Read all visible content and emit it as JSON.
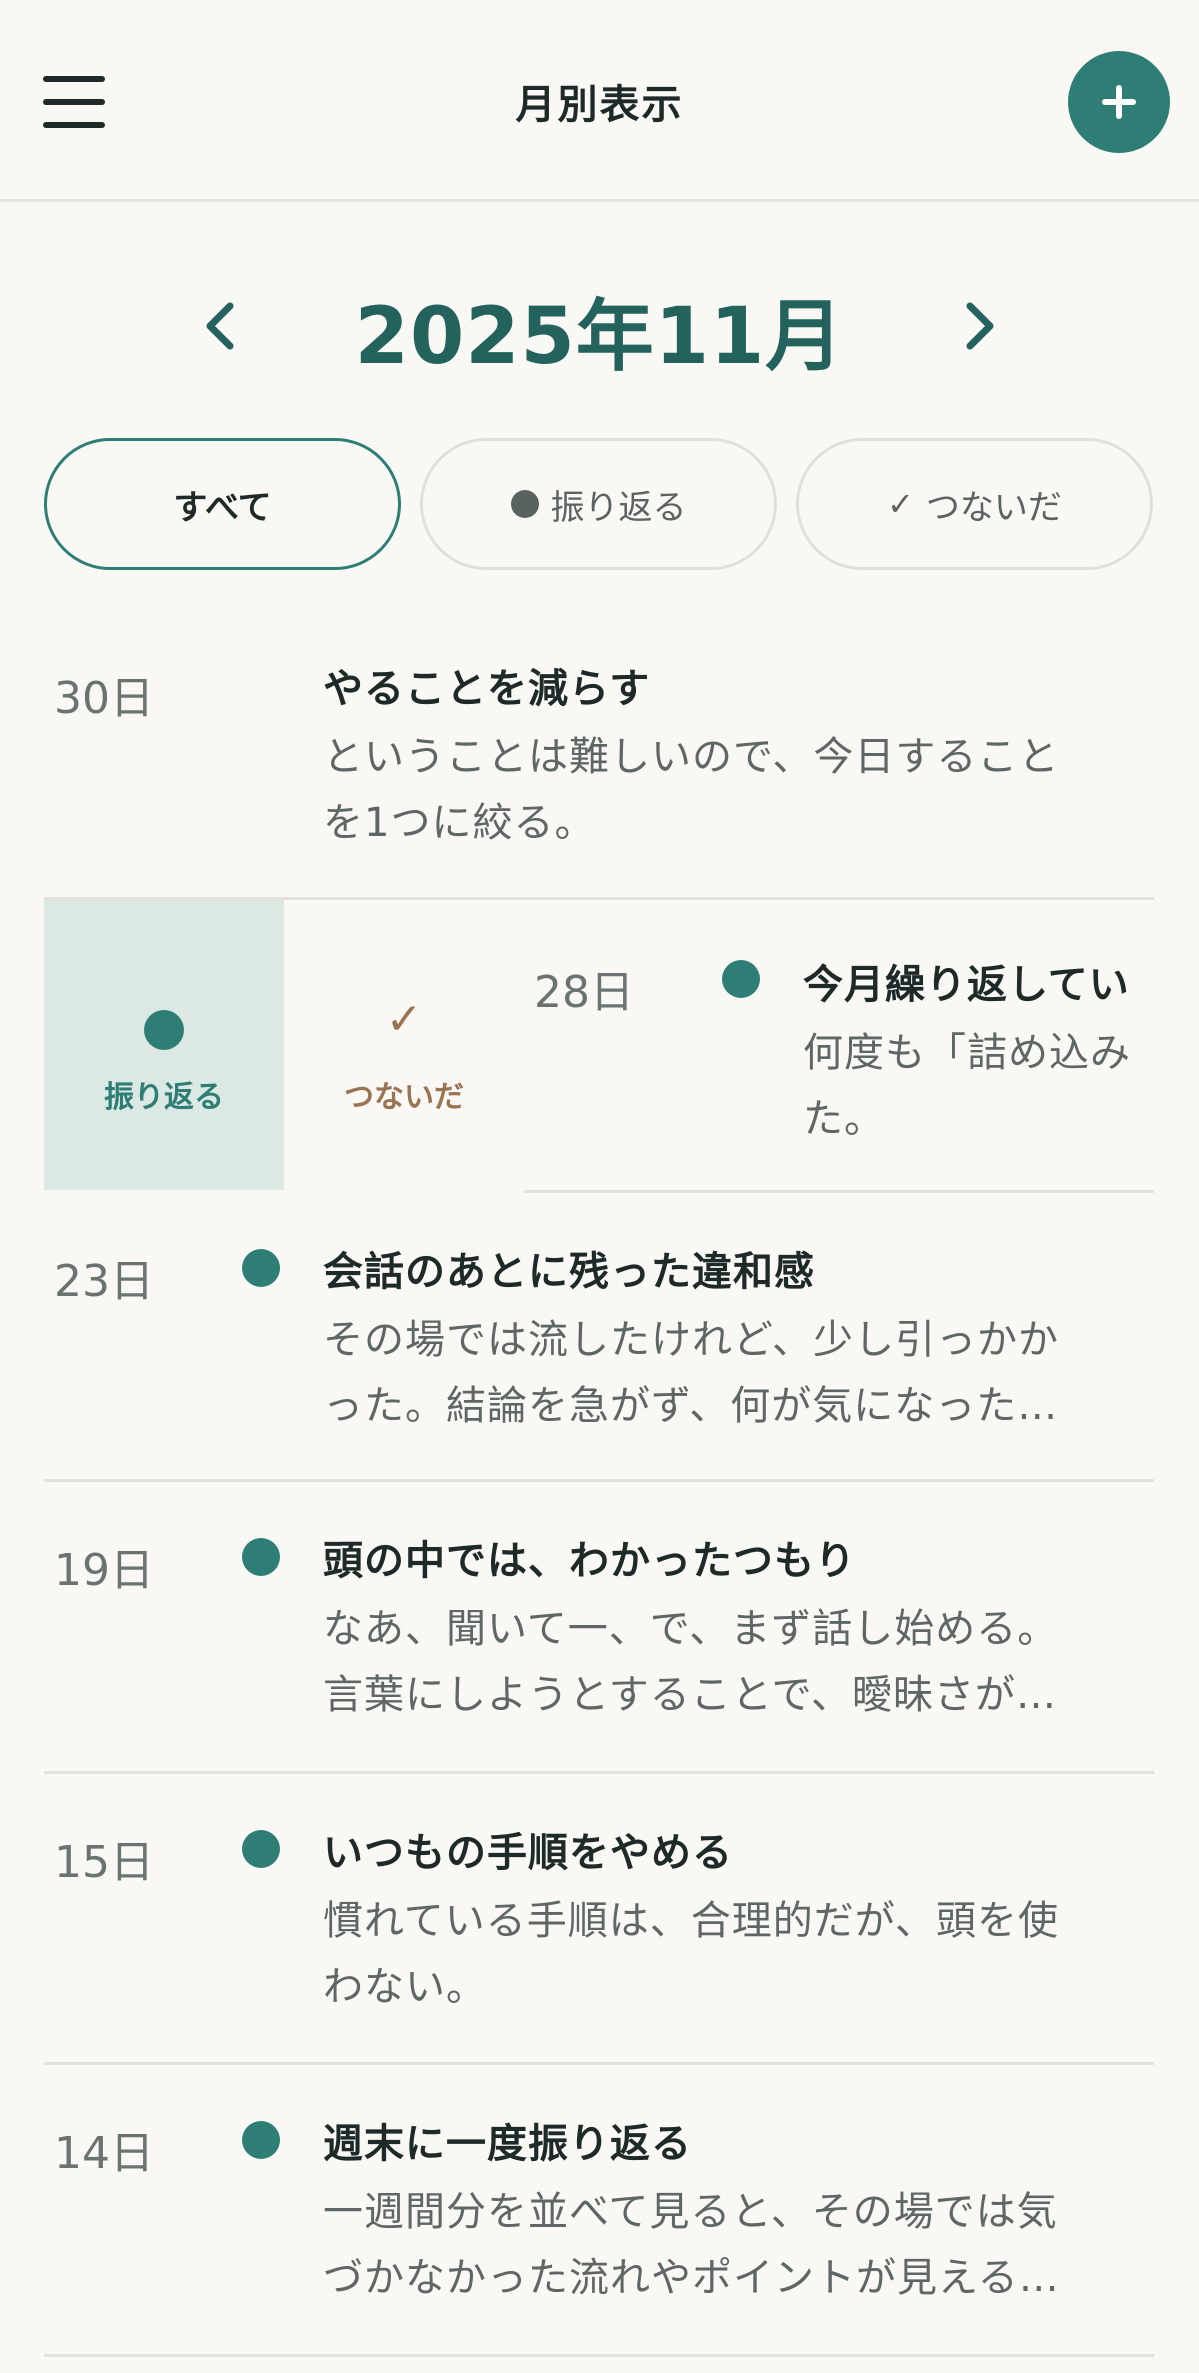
{
  "header": {
    "title": "月別表示"
  },
  "month_nav": {
    "title": "2025年11月"
  },
  "filters": {
    "all": "すべて",
    "reflect": "振り返る",
    "connect": "つないだ",
    "check_glyph": "✓"
  },
  "swipe_actions": {
    "reflect": "振り返る",
    "connect": "つないだ",
    "check_glyph": "✓"
  },
  "entries": [
    {
      "date": "30日",
      "title": "やることを減らす",
      "body_line1": "ということは難しいので、今日すること",
      "body_line2": "を1つに絞る。"
    },
    {
      "date": "28日",
      "title": "今月繰り返してい",
      "body_line1": "何度も「詰め込み",
      "body_line2": "た。"
    },
    {
      "date": "23日",
      "title": "会話のあとに残った違和感",
      "body_line1": "その場では流したけれど、少し引っかか",
      "body_line2": "った。結論を急がず、何が気になった…"
    },
    {
      "date": "19日",
      "title": "頭の中では、わかったつもり",
      "body_line1": "なあ、聞いて一、で、まず話し始める。",
      "body_line2": "言葉にしようとすることで、曖昧さが…"
    },
    {
      "date": "15日",
      "title": "いつもの手順をやめる",
      "body_line1": "慣れている手順は、合理的だが、頭を使",
      "body_line2": "わない。"
    },
    {
      "date": "14日",
      "title": "週末に一度振り返る",
      "body_line1": "一週間分を並べて見ると、その場では気",
      "body_line2": "づかなかった流れやポイントが見える…"
    }
  ],
  "colors": {
    "accent": "#2f7e75",
    "month_title": "#24635d",
    "connect_brown": "#9a7452",
    "background": "#f9f8f4"
  },
  "icons": {
    "menu": "hamburger-icon",
    "add": "plus-icon",
    "prev": "chevron-left-icon",
    "next": "chevron-right-icon",
    "reflect": "dot-icon",
    "connect": "check-icon"
  }
}
